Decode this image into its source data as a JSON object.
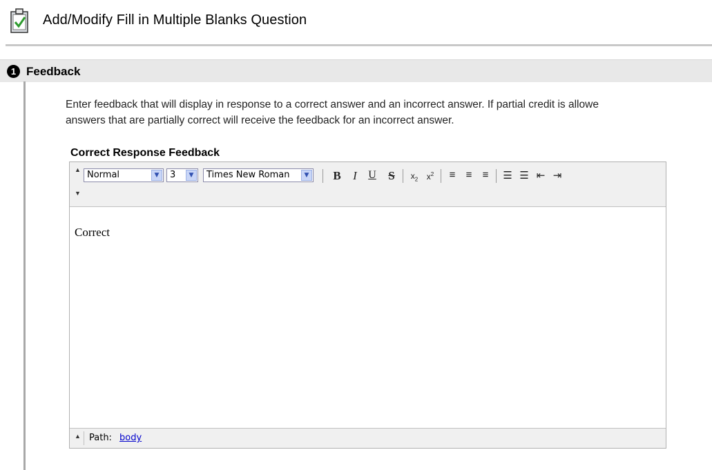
{
  "page": {
    "title": "Add/Modify Fill in Multiple Blanks Question",
    "icon": "clipboard-check-icon"
  },
  "section": {
    "number": "1",
    "title": "Feedback",
    "instructions_line1": "Enter feedback that will display in response to a correct answer and an incorrect answer. If partial credit is allowe",
    "instructions_line2": "answers that are partially correct will receive the feedback for an incorrect answer."
  },
  "editor": {
    "label": "Correct Response Feedback",
    "format_select": "Normal",
    "size_select": "3",
    "font_select": "Times New Roman",
    "toolbar_icons": [
      "bold-icon",
      "italic-icon",
      "underline-icon",
      "strikethrough-icon",
      "subscript-icon",
      "superscript-icon",
      "align-left-icon",
      "align-center-icon",
      "align-right-icon",
      "ordered-list-icon",
      "unordered-list-icon",
      "outdent-icon",
      "indent-icon"
    ],
    "content": "Correct",
    "path_label": "Path:",
    "path_value": "body"
  },
  "colors": {
    "link": "#0000cc",
    "section_bar": "#e8e8e8",
    "toolbar_bg": "#f0f0f0"
  }
}
